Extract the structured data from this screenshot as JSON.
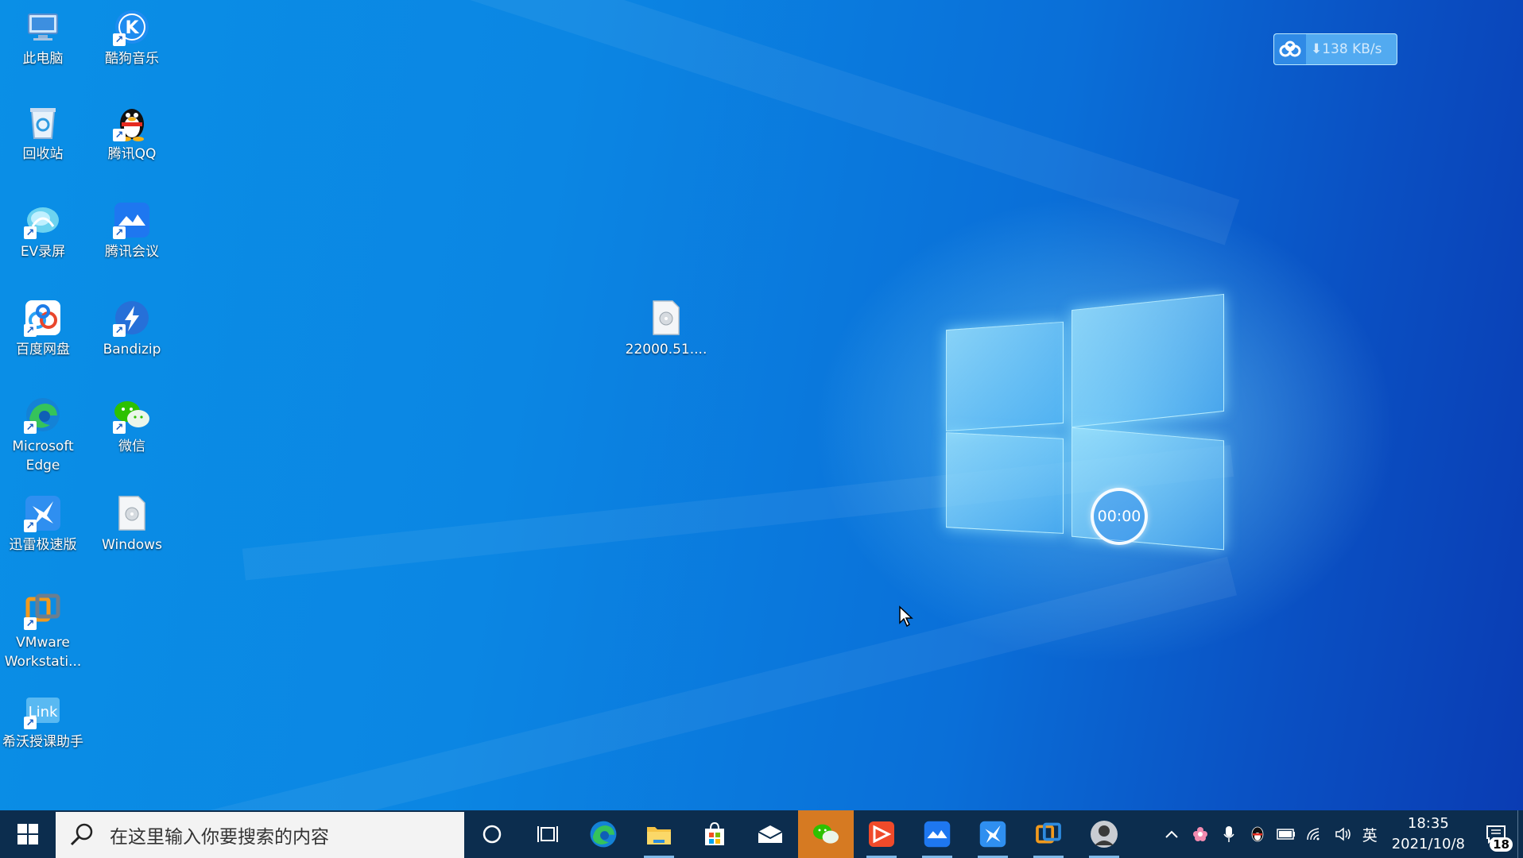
{
  "desktop": {
    "icons": [
      {
        "id": "this-pc",
        "label": "此电脑"
      },
      {
        "id": "kugou",
        "label": "酷狗音乐"
      },
      {
        "id": "recycle-bin",
        "label": "回收站"
      },
      {
        "id": "qq",
        "label": "腾讯QQ"
      },
      {
        "id": "ev",
        "label": "EV录屏"
      },
      {
        "id": "tencent-meeting",
        "label": "腾讯会议"
      },
      {
        "id": "baidu-netdisk",
        "label": "百度网盘"
      },
      {
        "id": "bandizip",
        "label": "Bandizip"
      },
      {
        "id": "edge",
        "label": "Microsoft\nEdge"
      },
      {
        "id": "wechat",
        "label": "微信"
      },
      {
        "id": "xunlei",
        "label": "迅雷极速版"
      },
      {
        "id": "windows-file",
        "label": "Windows"
      },
      {
        "id": "vmware",
        "label": "VMware\nWorkstati..."
      },
      {
        "id": "xiwo",
        "label": "希沃授课助手"
      },
      {
        "id": "iso-file",
        "label": "22000.51...."
      }
    ]
  },
  "net_speed": {
    "text": "⬇138 KB/s"
  },
  "timer": {
    "text": "00:00"
  },
  "taskbar": {
    "search_placeholder": "在这里输入你要搜索的内容",
    "ime": "英",
    "time": "18:35",
    "date": "2021/10/8",
    "notification_count": "18"
  }
}
